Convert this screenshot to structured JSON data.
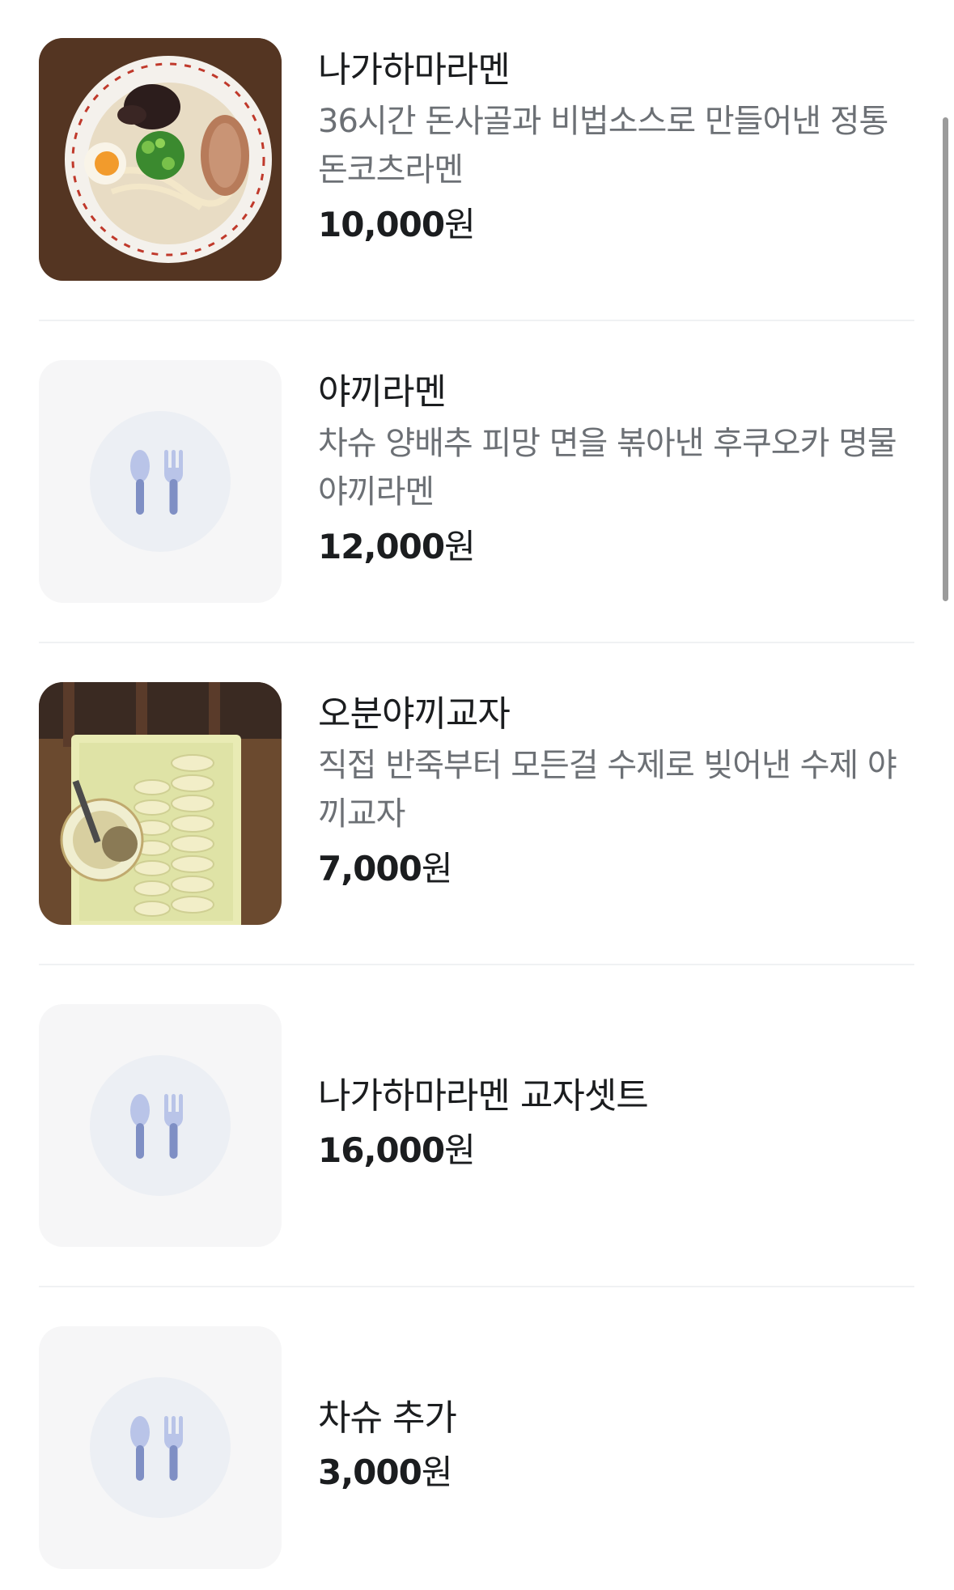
{
  "menu_items": [
    {
      "name": "나가하마라멘",
      "description": "36시간 돈사골과 비법소스로 만들어낸 정통 돈코츠라멘",
      "price": "10,000",
      "currency": "원",
      "image": "ramen-photo"
    },
    {
      "name": "야끼라멘",
      "description": "차슈 양배추 피망 면을 볶아낸 후쿠오카 명물 야끼라멘",
      "price": "12,000",
      "currency": "원",
      "image": "utensils-placeholder-icon"
    },
    {
      "name": "오분야끼교자",
      "description": "직접 반죽부터 모든걸 수제로 빚어낸 수제 야끼교자",
      "price": "7,000",
      "currency": "원",
      "image": "gyoza-photo"
    },
    {
      "name": "나가하마라멘 교자셋트",
      "price": "16,000",
      "currency": "원",
      "image": "utensils-placeholder-icon"
    },
    {
      "name": "차슈 추가",
      "price": "3,000",
      "currency": "원",
      "image": "utensils-placeholder-icon"
    }
  ],
  "colors": {
    "text": "#1b1d1f",
    "subtext": "#6c7075",
    "placeholder_bg": "#f6f6f7",
    "placeholder_circle": "#eceff4",
    "icon": "#7f8fc4",
    "divider": "#f0f1f3"
  }
}
